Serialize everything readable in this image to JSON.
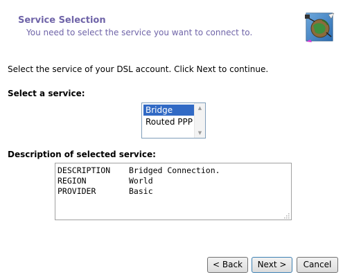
{
  "header": {
    "title": "Service Selection",
    "subtitle": "You need to select the service you want to connect to.",
    "icon": "globe-network-icon"
  },
  "instruction": "Select the service of your DSL account. Click Next to continue.",
  "service_list": {
    "label": "Select a service:",
    "items": [
      "Bridge",
      "Routed PPP"
    ],
    "selected": "Bridge"
  },
  "description": {
    "label": "Description of selected service:",
    "rows": [
      {
        "key": "DESCRIPTION",
        "value": "Bridged Connection."
      },
      {
        "key": "REGION",
        "value": "World"
      },
      {
        "key": "PROVIDER",
        "value": "Basic"
      }
    ]
  },
  "buttons": {
    "back": "< Back",
    "next": "Next >",
    "cancel": "Cancel"
  },
  "colors": {
    "header_text": "#6f64a8",
    "selection": "#316ac5"
  }
}
